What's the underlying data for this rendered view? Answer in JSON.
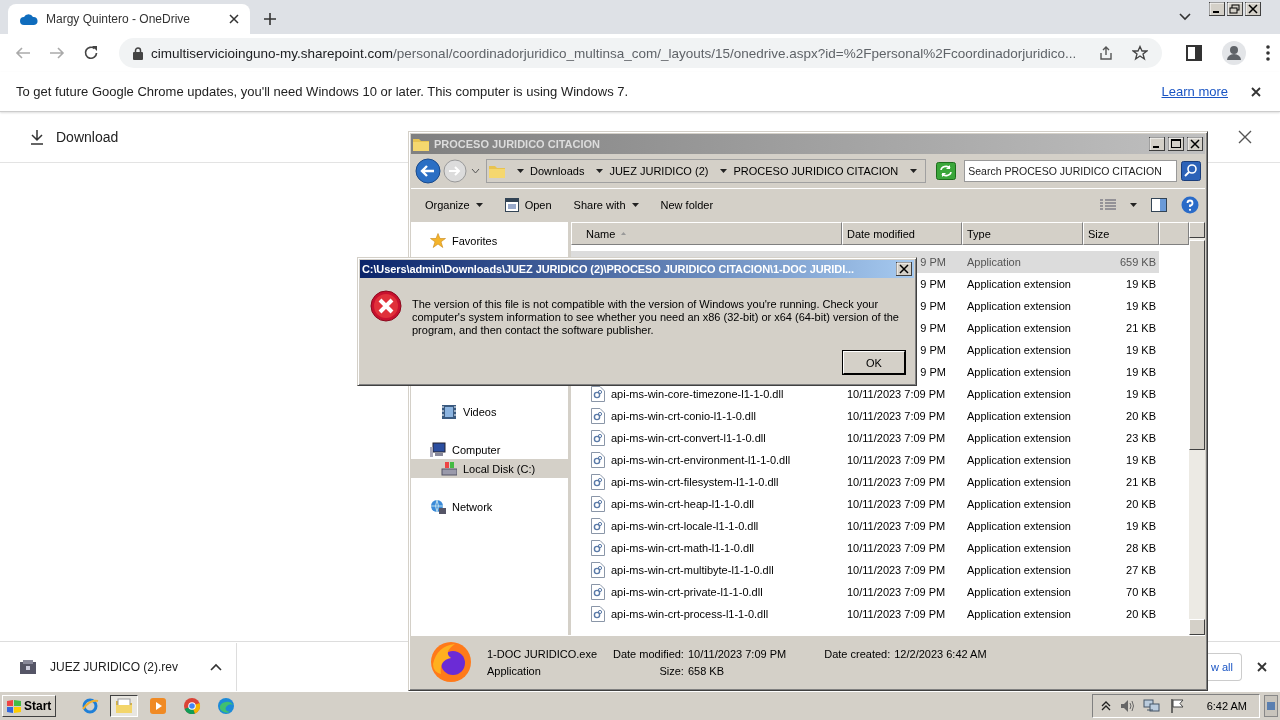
{
  "browser": {
    "tab": {
      "title": "Margy Quintero - OneDrive",
      "selected": true
    },
    "url": {
      "host": "cimultiservicioinguno-my.sharepoint.com",
      "path": "/personal/coordinadorjuridico_multinsa_com/_layouts/15/onedrive.aspx?id=%2Fpersonal%2Fcoordinadorjuridico..."
    }
  },
  "infobar": {
    "message": "To get future Google Chrome updates, you'll need Windows 10 or later. This computer is using Windows 7.",
    "link": "Learn more"
  },
  "page": {
    "action": "Download"
  },
  "explorer": {
    "title": "PROCESO JURIDICO CITACION",
    "breadcrumbs": [
      "Downloads",
      "JUEZ JURIDICO (2)",
      "PROCESO JURIDICO CITACION"
    ],
    "search": {
      "placeholder": "Search PROCESO JURIDICO CITACION"
    },
    "toolbar": [
      {
        "label": "Organize",
        "kind": "menu"
      },
      {
        "label": "Open",
        "kind": "open"
      },
      {
        "label": "Share with",
        "kind": "menu"
      },
      {
        "label": "New folder",
        "kind": "plain"
      }
    ],
    "nav": [
      {
        "label": "Favorites",
        "kind": "favorites",
        "selected": false
      },
      {
        "label": "Videos",
        "kind": "videos",
        "selected": false
      },
      {
        "label": "Computer",
        "kind": "computer",
        "selected": false,
        "children": [
          {
            "label": "Local Disk (C:)",
            "kind": "drive",
            "selected": true
          }
        ]
      },
      {
        "label": "Network",
        "kind": "network",
        "selected": false
      }
    ],
    "columns": [
      "Name",
      "Date modified",
      "Type",
      "Size"
    ],
    "rows": [
      {
        "kind": "covered",
        "date": "9 PM",
        "type": "Application",
        "size": "659 KB",
        "selected": true
      },
      {
        "kind": "covered",
        "date": "9 PM",
        "type": "Application extension",
        "size": "19 KB",
        "selected": false
      },
      {
        "kind": "covered",
        "date": "9 PM",
        "type": "Application extension",
        "size": "19 KB",
        "selected": false
      },
      {
        "kind": "covered",
        "date": "9 PM",
        "type": "Application extension",
        "size": "21 KB",
        "selected": false
      },
      {
        "kind": "covered",
        "date": "9 PM",
        "type": "Application extension",
        "size": "19 KB",
        "selected": false
      },
      {
        "kind": "covered",
        "date": "9 PM",
        "type": "Application extension",
        "size": "19 KB",
        "selected": false
      },
      {
        "kind": "file",
        "name": "api-ms-win-core-timezone-l1-1-0.dll",
        "date": "10/11/2023 7:09 PM",
        "type": "Application extension",
        "size": "19 KB",
        "selected": false
      },
      {
        "kind": "file",
        "name": "api-ms-win-crt-conio-l1-1-0.dll",
        "date": "10/11/2023 7:09 PM",
        "type": "Application extension",
        "size": "20 KB",
        "selected": false
      },
      {
        "kind": "file",
        "name": "api-ms-win-crt-convert-l1-1-0.dll",
        "date": "10/11/2023 7:09 PM",
        "type": "Application extension",
        "size": "23 KB",
        "selected": false
      },
      {
        "kind": "file",
        "name": "api-ms-win-crt-environment-l1-1-0.dll",
        "date": "10/11/2023 7:09 PM",
        "type": "Application extension",
        "size": "19 KB",
        "selected": false
      },
      {
        "kind": "file",
        "name": "api-ms-win-crt-filesystem-l1-1-0.dll",
        "date": "10/11/2023 7:09 PM",
        "type": "Application extension",
        "size": "21 KB",
        "selected": false
      },
      {
        "kind": "file",
        "name": "api-ms-win-crt-heap-l1-1-0.dll",
        "date": "10/11/2023 7:09 PM",
        "type": "Application extension",
        "size": "20 KB",
        "selected": false
      },
      {
        "kind": "file",
        "name": "api-ms-win-crt-locale-l1-1-0.dll",
        "date": "10/11/2023 7:09 PM",
        "type": "Application extension",
        "size": "19 KB",
        "selected": false
      },
      {
        "kind": "file",
        "name": "api-ms-win-crt-math-l1-1-0.dll",
        "date": "10/11/2023 7:09 PM",
        "type": "Application extension",
        "size": "28 KB",
        "selected": false
      },
      {
        "kind": "file",
        "name": "api-ms-win-crt-multibyte-l1-1-0.dll",
        "date": "10/11/2023 7:09 PM",
        "type": "Application extension",
        "size": "27 KB",
        "selected": false
      },
      {
        "kind": "file",
        "name": "api-ms-win-crt-private-l1-1-0.dll",
        "date": "10/11/2023 7:09 PM",
        "type": "Application extension",
        "size": "70 KB",
        "selected": false
      },
      {
        "kind": "file",
        "name": "api-ms-win-crt-process-l1-1-0.dll",
        "date": "10/11/2023 7:09 PM",
        "type": "Application extension",
        "size": "20 KB",
        "selected": false
      }
    ],
    "details": {
      "name": "1-DOC JURIDICO.exe",
      "type": "Application",
      "fields": [
        {
          "label": "Date modified:",
          "value": "10/11/2023 7:09 PM"
        },
        {
          "label": "Size:",
          "value": "658 KB"
        },
        {
          "label": "Date created:",
          "value": "12/2/2023 6:42 AM"
        }
      ]
    }
  },
  "dialog": {
    "title": "C:\\Users\\admin\\Downloads\\JUEZ JURIDICO (2)\\PROCESO JURIDICO CITACION\\1-DOC JURIDI...",
    "message": "The version of this file is not compatible with the version of Windows you're running. Check your computer's system information to see whether you need an x86 (32-bit) or x64 (64-bit) version of the program, and then contact the software publisher.",
    "button": "OK"
  },
  "downloads": {
    "items": [
      {
        "name": "JUEZ JURIDICO (2).rev"
      }
    ],
    "show_all": "w all"
  },
  "taskbar": {
    "start": "Start",
    "apps": [
      {
        "kind": "ie",
        "selected": false
      },
      {
        "kind": "explorer",
        "selected": true
      },
      {
        "kind": "media",
        "selected": false
      },
      {
        "kind": "chrome",
        "selected": false
      },
      {
        "kind": "edge",
        "selected": false
      }
    ],
    "clock": "6:42 AM"
  }
}
